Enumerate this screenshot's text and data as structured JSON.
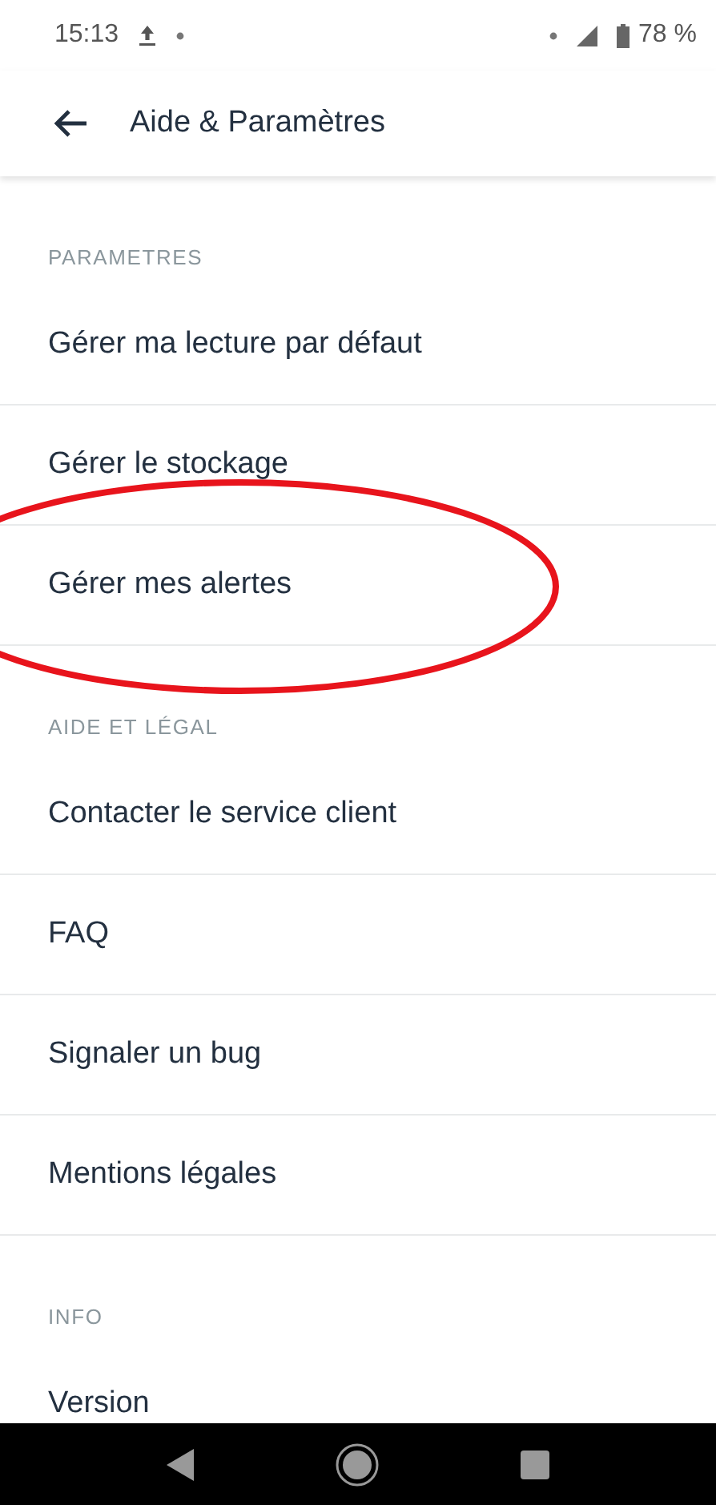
{
  "status_bar": {
    "time": "15:13",
    "battery": "78 %"
  },
  "header": {
    "title": "Aide & Paramètres"
  },
  "sections": [
    {
      "title": "PARAMETRES",
      "items": [
        {
          "label": "Gérer ma lecture par défaut"
        },
        {
          "label": "Gérer le stockage"
        },
        {
          "label": "Gérer mes alertes"
        }
      ]
    },
    {
      "title": "AIDE ET LÉGAL",
      "items": [
        {
          "label": "Contacter le service client"
        },
        {
          "label": "FAQ"
        },
        {
          "label": "Signaler un bug"
        },
        {
          "label": "Mentions légales"
        }
      ]
    },
    {
      "title": "INFO",
      "items": [
        {
          "label": "Version"
        }
      ]
    }
  ]
}
